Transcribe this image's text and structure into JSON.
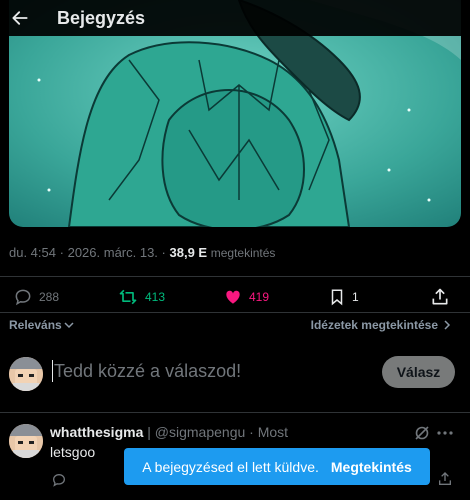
{
  "header": {
    "title": "Bejegyzés"
  },
  "post": {
    "time": "du. 4:54",
    "sep": "·",
    "date": "2026. márc. 13.",
    "views_count": "38,9 E",
    "views_label": "megtekintés"
  },
  "actions": {
    "replies": "288",
    "reposts": "413",
    "likes": "419",
    "bookmarks": "1"
  },
  "colors": {
    "repost": "#00ba7c",
    "like": "#f91880",
    "accent": "#1d9bf0",
    "muted": "#71767b"
  },
  "sort": {
    "label": "Releváns",
    "quotes": "Idézetek megtekintése"
  },
  "compose": {
    "placeholder": "Tedd közzé a válaszod!",
    "reply_button": "Válasz"
  },
  "reply": {
    "name": "whatthesigma",
    "separator": " | ",
    "handle": "@sigmapengu",
    "dot": " · ",
    "time": "Most",
    "text": "letsgoo"
  },
  "toast": {
    "message": "A bejegyzésed el lett küldve.",
    "link": "Megtekintés"
  }
}
